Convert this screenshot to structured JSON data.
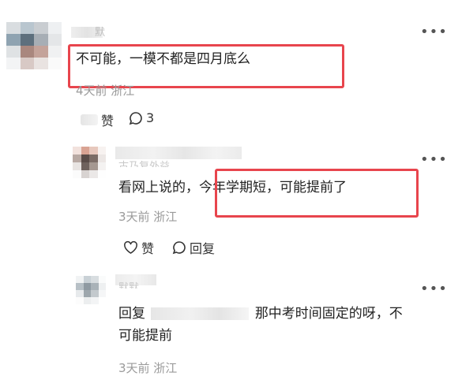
{
  "colors": {
    "highlight_border": "#e8454d",
    "meta_text": "#9a9a9a",
    "body_text": "#222222"
  },
  "comments": [
    {
      "author_partial": "默",
      "content": "不可能，一模不都是四月底么",
      "meta": "4天前 浙江",
      "like_label": "赞",
      "comment_count": "3"
    },
    {
      "author_partial": "古乃复外益",
      "content": "看网上说的，今年学期短，可能提前了",
      "meta": "3天前 浙江",
      "like_label": "赞",
      "reply_label": "回复"
    },
    {
      "author_partial": "默默",
      "content_prefix": "回复",
      "content_suffix": "那中考时间固定的呀，不",
      "content_line2": "可能提前",
      "meta": "3天前 浙江"
    }
  ],
  "icons": [
    "more-icon",
    "heart-icon",
    "comment-icon"
  ]
}
